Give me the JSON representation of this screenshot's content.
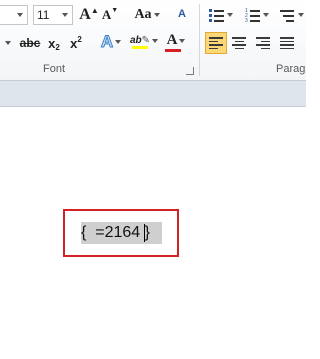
{
  "ribbon": {
    "font_group": {
      "label": "Font",
      "size_value": "11",
      "buttons": {
        "grow": "A",
        "shrink": "A",
        "change_case": "Aa",
        "clear_format": "A",
        "strikethrough": "abc",
        "subscript": "x",
        "subscript_mark": "2",
        "superscript": "x",
        "superscript_mark": "2",
        "text_effects": "A",
        "highlight": "ab",
        "font_color": "A"
      }
    },
    "paragraph_group": {
      "label": "Parag"
    }
  },
  "document": {
    "field_code": "{  =2164 }"
  },
  "colors": {
    "highlight_border": "#d42126",
    "field_shading": "#cfcfcf",
    "active_align": "#fbd775",
    "font_color_bar": "#d42126",
    "highlight_bar": "#ffff00"
  }
}
